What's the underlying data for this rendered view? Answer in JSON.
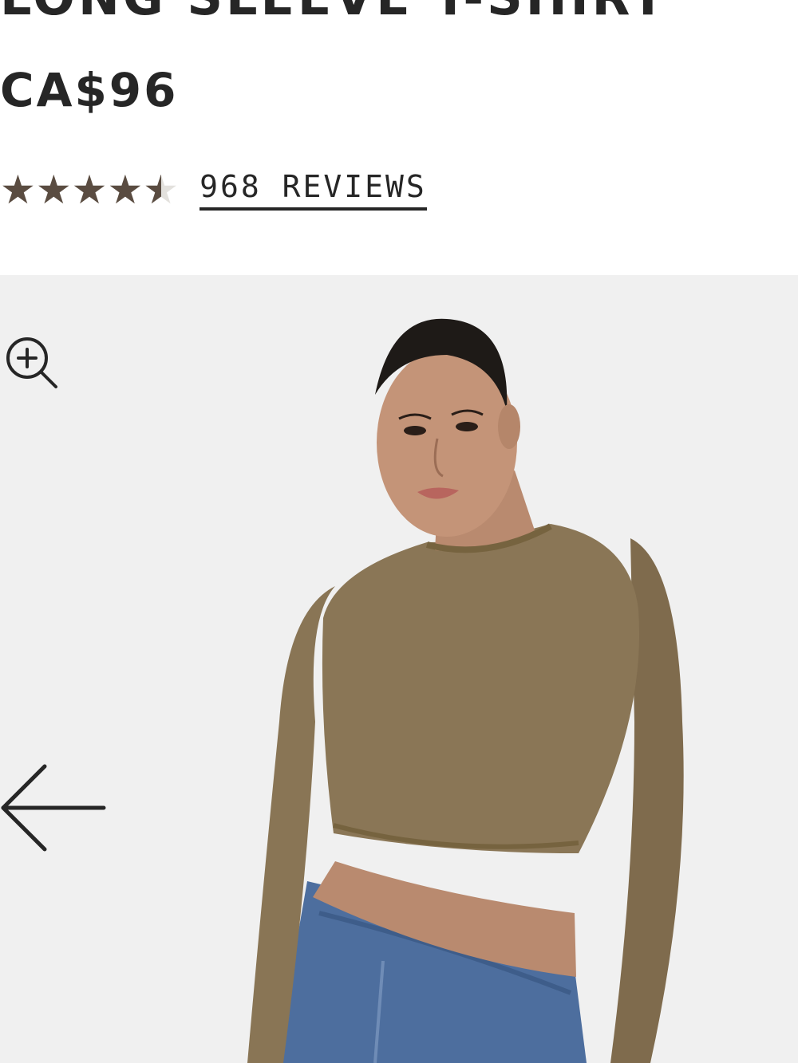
{
  "product": {
    "title": "LONG SLEEVE T-SHIRT",
    "price": "CA$96"
  },
  "rating": {
    "value": 4.5,
    "max": 5,
    "reviews_label": "968 REVIEWS",
    "star_color": "#5a4c41",
    "star_empty_color": "#e3e1dd"
  },
  "gallery": {
    "background_color": "#f0f0f0",
    "garment_color": "#8a7656",
    "controls": {
      "zoom_icon": "zoom-in-icon",
      "prev_icon": "arrow-left-icon"
    }
  }
}
